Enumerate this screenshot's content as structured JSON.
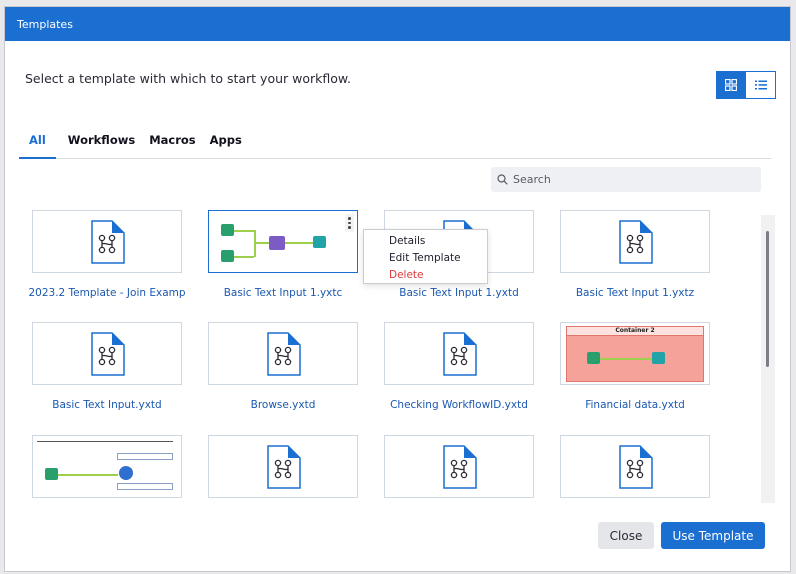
{
  "window": {
    "title": "Templates"
  },
  "subtitle": "Select a template with which to start your workflow.",
  "view_toggle": [
    {
      "name": "grid-view",
      "icon": "grid-icon",
      "active": true
    },
    {
      "name": "list-view",
      "icon": "list-icon",
      "active": false
    }
  ],
  "tabs": [
    {
      "label": "All",
      "active": true
    },
    {
      "label": "Workflows",
      "active": false
    },
    {
      "label": "Macros",
      "active": false
    },
    {
      "label": "Apps",
      "active": false
    }
  ],
  "search": {
    "placeholder": "Search",
    "value": ""
  },
  "templates": [
    {
      "name": "2023.2 Template - Join Examp",
      "thumb": "file-workflow-icon"
    },
    {
      "name": "Basic Text Input 1.yxtc",
      "thumb": "workflow-preview-join",
      "selected": true
    },
    {
      "name": "Basic Text Input 1.yxtd",
      "thumb": "file-workflow-icon"
    },
    {
      "name": "Basic Text Input 1.yxtz",
      "thumb": "file-workflow-icon"
    },
    {
      "name": "Basic Text Input.yxtd",
      "thumb": "file-workflow-icon"
    },
    {
      "name": "Browse.yxtd",
      "thumb": "file-workflow-icon"
    },
    {
      "name": "Checking WorkflowID.yxtd",
      "thumb": "file-workflow-icon"
    },
    {
      "name": "Financial data.yxtd",
      "thumb": "workflow-preview-container"
    },
    {
      "name": "",
      "thumb": "workflow-preview-annotated"
    },
    {
      "name": "",
      "thumb": "file-workflow-icon"
    },
    {
      "name": "",
      "thumb": "file-workflow-icon"
    },
    {
      "name": "",
      "thumb": "file-workflow-icon"
    }
  ],
  "container_label": "Container 2",
  "context_menu": {
    "items": [
      {
        "label": "Details"
      },
      {
        "label": "Edit Template"
      },
      {
        "label": "Delete",
        "danger": true
      }
    ]
  },
  "footer": {
    "close_label": "Close",
    "use_label": "Use Template"
  },
  "colors": {
    "accent": "#1a6fd1",
    "danger": "#d83a3a",
    "container_fill": "#f5a29b"
  }
}
